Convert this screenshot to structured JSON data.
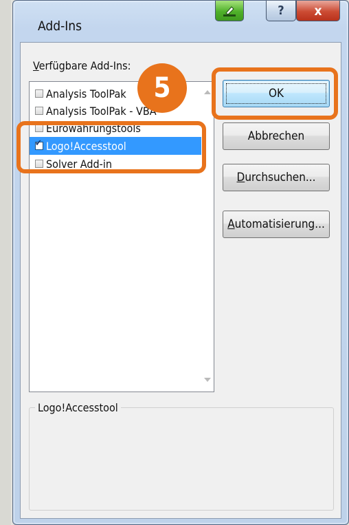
{
  "window": {
    "title": "Add-Ins",
    "help_glyph": "?",
    "close_glyph": "x"
  },
  "list": {
    "label": "Verfügbare Add-Ins:",
    "items": [
      {
        "label": "Analysis ToolPak",
        "checked": false,
        "selected": false
      },
      {
        "label": "Analysis ToolPak - VBA",
        "checked": false,
        "selected": false
      },
      {
        "label": "Eurowährungstools",
        "checked": false,
        "selected": false
      },
      {
        "label": "Logo!Accesstool",
        "checked": true,
        "selected": true
      },
      {
        "label": "Solver Add-in",
        "checked": false,
        "selected": false
      }
    ]
  },
  "buttons": {
    "ok": "OK",
    "cancel": "Abbrechen",
    "browse_accel": "D",
    "browse_rest": "urchsuchen...",
    "automation_accel": "A",
    "automation_rest": "utomatisierung..."
  },
  "description": {
    "group_label": "Logo!Accesstool"
  },
  "annotation": {
    "step_number": "5",
    "color": "#e8731c"
  },
  "colors": {
    "selection": "#3399ff",
    "dialog_bg": "#f0f0f0"
  }
}
